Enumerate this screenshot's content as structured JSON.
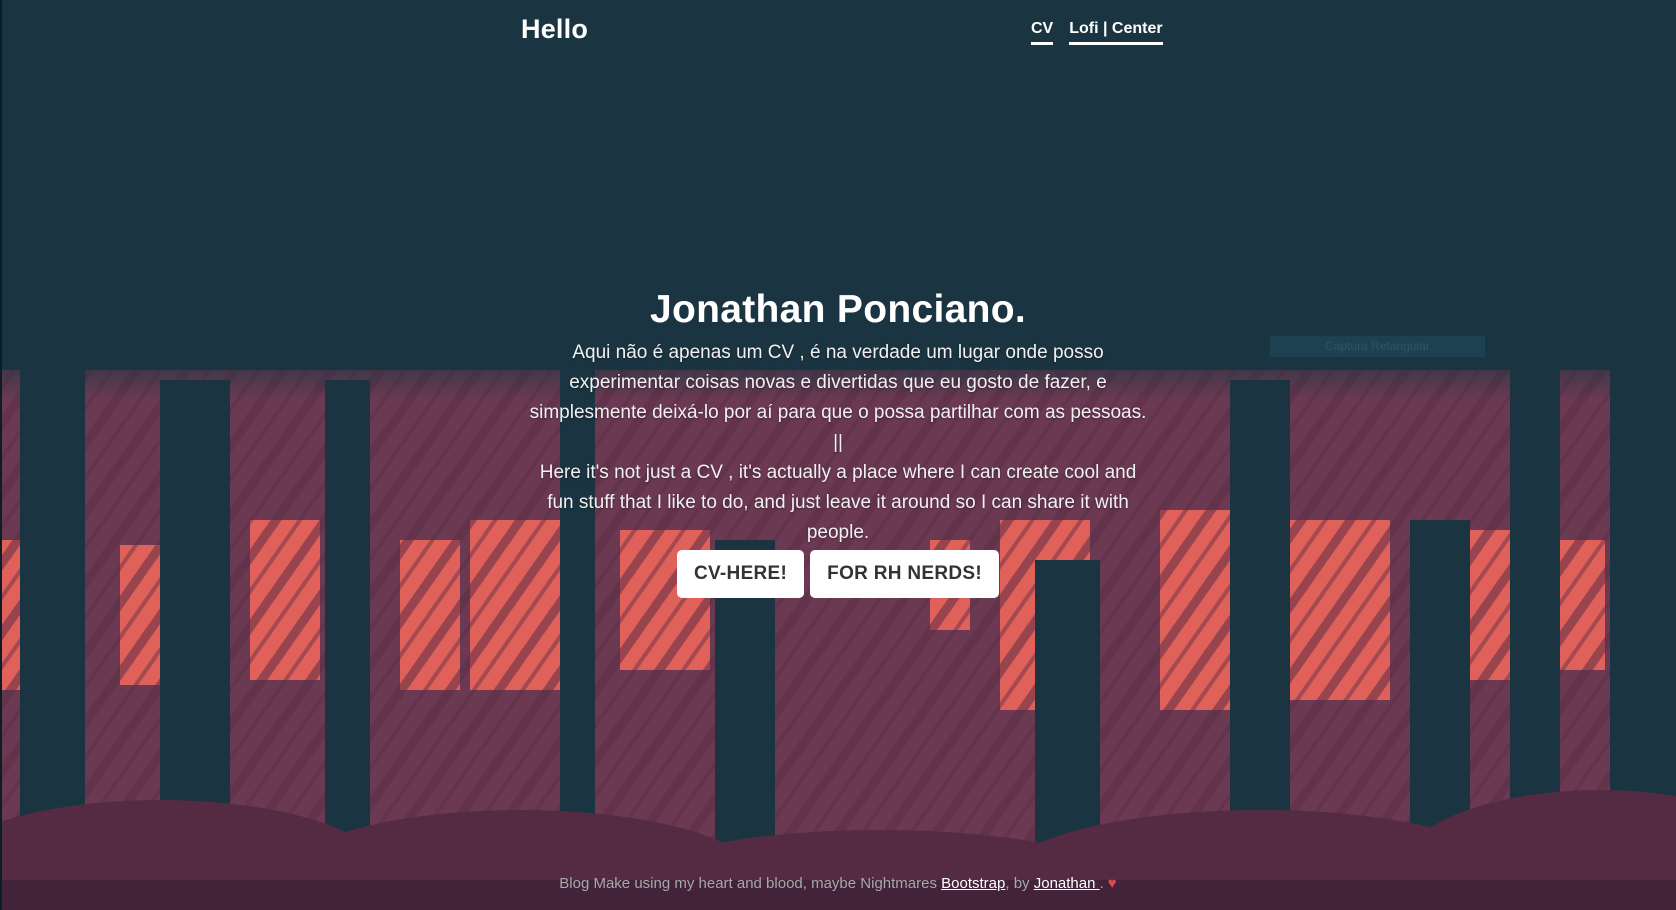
{
  "header": {
    "brand": "Hello",
    "nav": [
      {
        "label": "CV"
      },
      {
        "label": "Lofi | Center"
      }
    ]
  },
  "hero": {
    "title": "Jonathan Ponciano.",
    "text_pt": "Aqui não é apenas um CV , é na verdade um lugar onde posso experimentar coisas novas e divertidas que eu gosto de fazer, e simplesmente deixá-lo por aí para que o possa partilhar com as pessoas.",
    "separator": "||",
    "text_en": "Here it's not just a CV , it's actually a place where I can create cool and fun stuff that I like to do, and just leave it around so I can share it with people.",
    "buttons": [
      {
        "label": "CV-HERE!"
      },
      {
        "label": "FOR RH NERDS!"
      }
    ]
  },
  "overlay": {
    "capture_label": "Captura Retangular"
  },
  "footer": {
    "prefix": "Blog Make using my heart and blood, maybe Nightmares ",
    "link1": "Bootstrap",
    "middle": ", by ",
    "link2": "Jonathan ",
    "suffix": "."
  },
  "colors": {
    "background": "#1b3441",
    "forest_red": "#e06055",
    "forest_mauve": "#6e3b52",
    "button_bg": "#ffffff"
  }
}
